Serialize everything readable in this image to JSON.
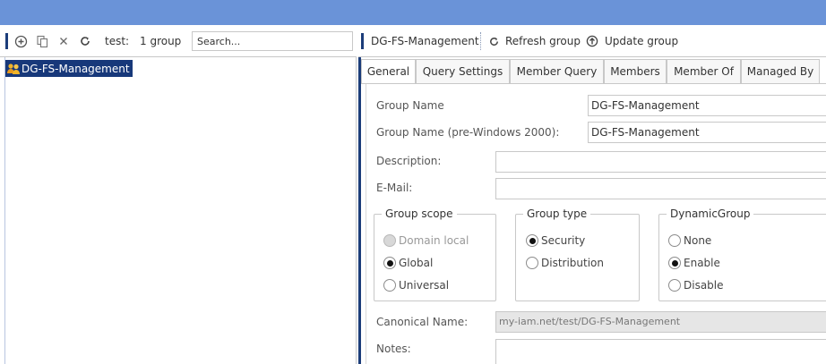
{
  "left_toolbar": {
    "icons": [
      "add-icon",
      "copy-icon",
      "close-icon",
      "refresh-icon"
    ],
    "context_label": "test:",
    "count_label": "1 group",
    "search_placeholder": "Search..."
  },
  "tree": {
    "items": [
      {
        "label": "DG-FS-Management",
        "icon": "group-icon",
        "selected": true
      }
    ]
  },
  "right_toolbar": {
    "title": "DG-FS-Management",
    "refresh_label": "Refresh group",
    "update_label": "Update group"
  },
  "tabs": [
    {
      "label": "General",
      "active": true
    },
    {
      "label": "Query Settings",
      "active": false
    },
    {
      "label": "Member Query",
      "active": false
    },
    {
      "label": "Members",
      "active": false
    },
    {
      "label": "Member Of",
      "active": false
    },
    {
      "label": "Managed By",
      "active": false
    }
  ],
  "form": {
    "group_name_label": "Group Name",
    "group_name_value": "DG-FS-Management",
    "group_name_pre2000_label": "Group Name (pre-Windows 2000):",
    "group_name_pre2000_value": "DG-FS-Management",
    "description_label": "Description:",
    "description_value": "",
    "email_label": "E-Mail:",
    "email_value": "",
    "canonical_name_label": "Canonical Name:",
    "canonical_name_value": "my-iam.net/test/DG-FS-Management",
    "notes_label": "Notes:",
    "notes_value": ""
  },
  "group_scope": {
    "title": "Group scope",
    "options": [
      {
        "label": "Domain local",
        "checked": false,
        "disabled": true
      },
      {
        "label": "Global",
        "checked": true,
        "disabled": false
      },
      {
        "label": "Universal",
        "checked": false,
        "disabled": false
      }
    ]
  },
  "group_type": {
    "title": "Group type",
    "options": [
      {
        "label": "Security",
        "checked": true,
        "disabled": false
      },
      {
        "label": "Distribution",
        "checked": false,
        "disabled": false
      }
    ]
  },
  "dynamic_group": {
    "title": "DynamicGroup",
    "options": [
      {
        "label": "None",
        "checked": false,
        "disabled": false
      },
      {
        "label": "Enable",
        "checked": true,
        "disabled": false
      },
      {
        "label": "Disable",
        "checked": false,
        "disabled": false
      }
    ]
  },
  "colors": {
    "top_bar": "#6a93d8",
    "selection": "#17387a",
    "accent": "#1c3d7a"
  }
}
